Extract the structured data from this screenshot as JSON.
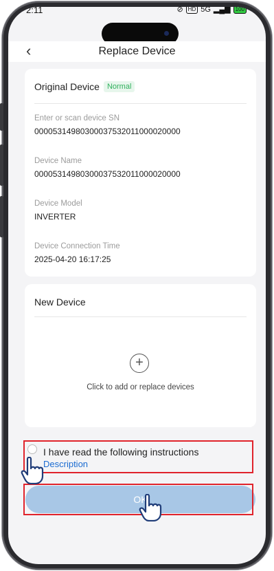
{
  "status_bar": {
    "time": "2:11",
    "indicators": [
      "HD",
      "5G",
      "100"
    ]
  },
  "header": {
    "back_icon": "chevron-left-icon",
    "title": "Replace Device"
  },
  "original_device": {
    "heading": "Original Device",
    "status": "Normal",
    "fields": [
      {
        "label": "Enter or scan device SN",
        "value": "00005314980300037532011000020000"
      },
      {
        "label": "Device Name",
        "value": "00005314980300037532011000020000"
      },
      {
        "label": "Device Model",
        "value": "INVERTER"
      },
      {
        "label": "Device Connection Time",
        "value": "2025-04-20 16:17:25"
      }
    ]
  },
  "new_device": {
    "heading": "New Device",
    "add_icon": "plus-circle-icon",
    "add_text": "Click to add or replace devices"
  },
  "agreement": {
    "text": "I have read the following instructions",
    "link": "Description"
  },
  "ok_button": {
    "label": "OK"
  },
  "colors": {
    "accent_blue": "#1a6bd1",
    "button_disabled": "#a8c7e6",
    "status_green": "#30b15d",
    "highlight_red": "#e0232b"
  }
}
